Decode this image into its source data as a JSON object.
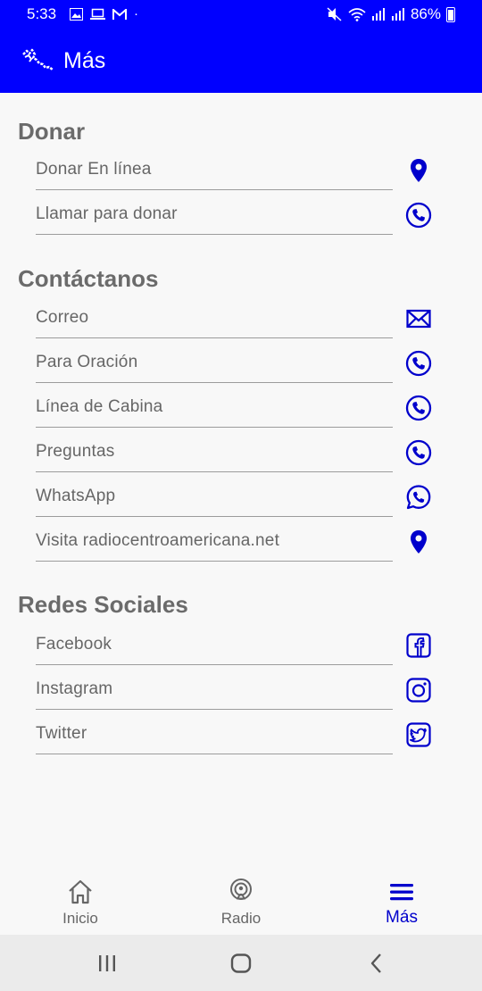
{
  "status_bar": {
    "time": "5:33",
    "battery": "86%"
  },
  "app_bar": {
    "title": "Más"
  },
  "sections": [
    {
      "title": "Donar",
      "items": [
        {
          "label": "Donar En línea",
          "icon": "location-pin-icon"
        },
        {
          "label": "Llamar para donar",
          "icon": "phone-icon"
        }
      ]
    },
    {
      "title": "Contáctanos",
      "items": [
        {
          "label": "Correo",
          "icon": "mail-icon"
        },
        {
          "label": "Para Oración",
          "icon": "phone-icon"
        },
        {
          "label": "Línea de Cabina",
          "icon": "phone-icon"
        },
        {
          "label": "Preguntas",
          "icon": "phone-icon"
        },
        {
          "label": "WhatsApp",
          "icon": "whatsapp-icon"
        },
        {
          "label": "Visita radiocentroamericana.net",
          "icon": "location-pin-icon"
        }
      ]
    },
    {
      "title": "Redes Sociales",
      "items": [
        {
          "label": "Facebook",
          "icon": "facebook-icon"
        },
        {
          "label": "Instagram",
          "icon": "instagram-icon"
        },
        {
          "label": "Twitter",
          "icon": "twitter-icon"
        }
      ]
    }
  ],
  "bottom_nav": {
    "items": [
      {
        "label": "Inicio",
        "icon": "home-icon",
        "active": false
      },
      {
        "label": "Radio",
        "icon": "radio-icon",
        "active": false
      },
      {
        "label": "Más",
        "icon": "menu-icon",
        "active": true
      }
    ]
  },
  "colors": {
    "primary": "#0000ff",
    "icon": "#0000cc",
    "text": "#666666"
  }
}
